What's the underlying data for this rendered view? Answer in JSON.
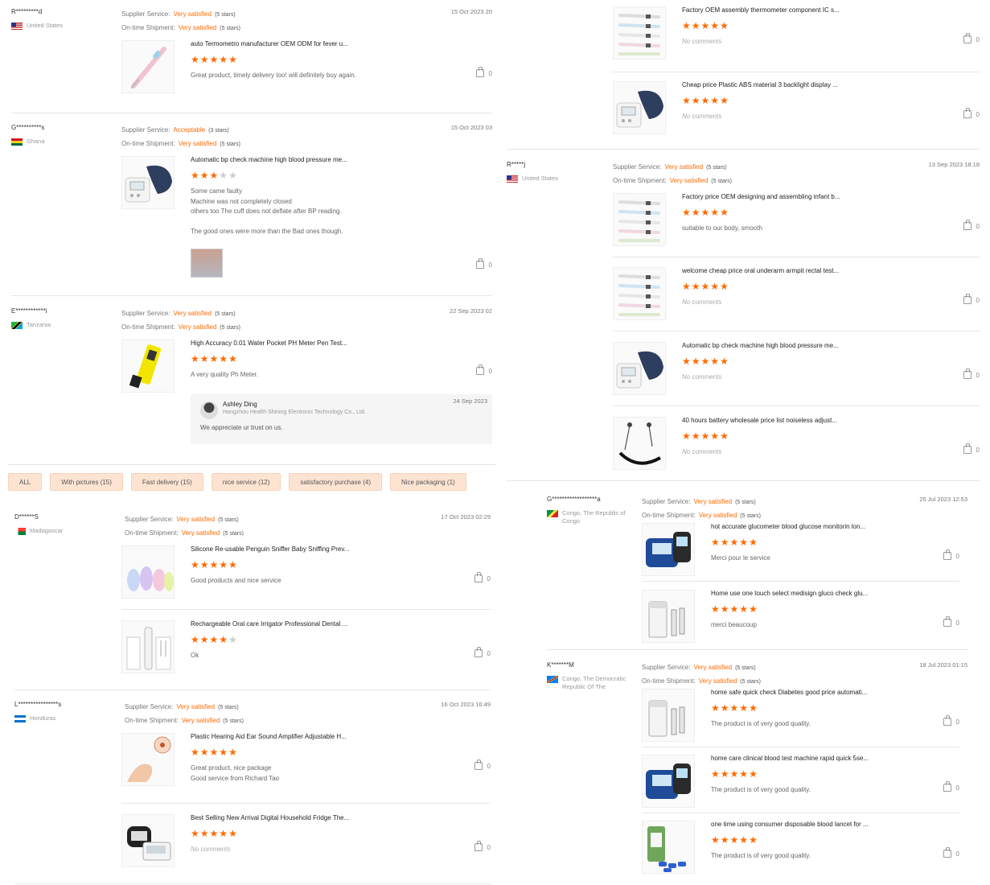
{
  "labels": {
    "supplier": "Supplier Service:",
    "ontime": "On-time Shipment:"
  },
  "tags": [
    "ALL",
    "With pictures (15)",
    "Fast delivery (15)",
    "nice service (12)",
    "satisfactory purchase (4)",
    "Nice packaging (1)"
  ],
  "reviews": [
    {
      "user": "R*********d",
      "country": "United States",
      "flag": "us",
      "supplier_rating": "Very satisfied",
      "supplier_stars": "(5 stars)",
      "ontime_rating": "Very satisfied",
      "ontime_stars": "(5 stars)",
      "date": "15 Oct 2023 20",
      "products": [
        {
          "title": "auto Termometro manufacturer OEM ODM for fever u...",
          "stars": 5,
          "comment": "Great product, timely delivery too! will definitely buy again.",
          "likes": "0",
          "icon": "thermometer-icon"
        }
      ]
    },
    {
      "user": "G**********s",
      "country": "Ghana",
      "flag": "gh",
      "supplier_rating": "Acceptable",
      "supplier_stars": "(3 stars)",
      "ontime_rating": "Very satisfied",
      "ontime_stars": "(5 stars)",
      "date": "15 Oct 2023 03",
      "products": [
        {
          "title": "Automatic bp check machine high blood pressure me...",
          "stars": 3,
          "comment": "Some came faulty\nMachine was not completely closed\nothers too The cuff does not deflate after BP reading.\n\nThe good ones were more than the Bad ones though.",
          "likes": "0",
          "icon": "bp-monitor-icon"
        }
      ]
    },
    {
      "user": "E************i",
      "country": "Tanzania",
      "flag": "tz",
      "supplier_rating": "Very satisfied",
      "supplier_stars": "(5 stars)",
      "ontime_rating": "Very satisfied",
      "ontime_stars": "(5 stars)",
      "date": "22 Sep 2023 02",
      "products": [
        {
          "title": "High Accuracy 0.01 Water Pocket PH Meter Pen Test...",
          "stars": 5,
          "comment": "A very quality Ph Meter.",
          "likes": "0",
          "icon": "ph-meter-icon"
        }
      ],
      "reply": {
        "name": "Ashley Ding",
        "company": "Hangzhou Health Shining Electronic Technology Co., Ltd.",
        "date": "24 Sep 2023",
        "text": "We appreciate ur trust on us."
      }
    },
    {
      "user": "D******S",
      "country": "Madagascar",
      "flag": "mg",
      "supplier_rating": "Very satisfied",
      "supplier_stars": "(5 stars)",
      "ontime_rating": "Very satisfied",
      "ontime_stars": "(5 stars)",
      "date": "17 Oct 2023 02:29",
      "products": [
        {
          "title": "Silicone Re-usable Penguin Sniffer Baby Sniffing Prev...",
          "stars": 5,
          "comment": "Good products and nice service",
          "likes": "0",
          "icon": "nasal-aspirator-icon"
        },
        {
          "title": "Rechargeable Oral care Irrigator Professional Dental ...",
          "stars": 4,
          "comment": "Ok",
          "likes": "0",
          "icon": "oral-irrigator-icon"
        }
      ]
    },
    {
      "user": "L****************s",
      "country": "Honduras",
      "flag": "hn",
      "supplier_rating": "Very satisfied",
      "supplier_stars": "(5 stars)",
      "ontime_rating": "Very satisfied",
      "ontime_stars": "(5 stars)",
      "date": "16 Oct 2023 16:49",
      "products": [
        {
          "title": "Plastic Hearing Aid Ear Sound Amplifier Adjustable H...",
          "stars": 5,
          "comment": "Great product, nice package\nGood service from Richard Tao",
          "likes": "0",
          "icon": "hearing-aid-icon"
        },
        {
          "title": "Best Selling New Arrival Digital Household Fridge The...",
          "stars": 5,
          "comment": "No comments",
          "likes": "0",
          "icon": "fridge-thermometer-icon"
        }
      ]
    },
    {
      "user": "",
      "country": "",
      "flag": "",
      "supplier_rating": "",
      "supplier_stars": "",
      "ontime_rating": "",
      "ontime_stars": "",
      "date": "",
      "products": [
        {
          "title": "Factory OEM assembly thermometer component IC s...",
          "stars": 5,
          "comment": "No comments",
          "likes": "0",
          "icon": "thermometer-set-icon"
        },
        {
          "title": "Cheap price Plastic ABS material 3 backlight display ...",
          "stars": 5,
          "comment": "No comments",
          "likes": "0",
          "icon": "bp-monitor-icon"
        }
      ]
    },
    {
      "user": "R*****j",
      "country": "United States",
      "flag": "us",
      "supplier_rating": "Very satisfied",
      "supplier_stars": "(5 stars)",
      "ontime_rating": "Very satisfied",
      "ontime_stars": "(5 stars)",
      "date": "13 Sep 2023 18:18",
      "products": [
        {
          "title": "Factory price OEM designing and assembling infant b...",
          "stars": 5,
          "comment": "suitable to our body, smooth",
          "likes": "0",
          "icon": "thermometer-set-icon"
        },
        {
          "title": "welcome cheap price oral underarm armpit rectal test...",
          "stars": 5,
          "comment": "No comments",
          "likes": "0",
          "icon": "thermometer-set-icon"
        },
        {
          "title": "Automatic bp check machine high blood pressure me...",
          "stars": 5,
          "comment": "No comments",
          "likes": "0",
          "icon": "bp-monitor-icon"
        },
        {
          "title": "40 hours battery wholesale price list noiseless adjust...",
          "stars": 5,
          "comment": "No comments",
          "likes": "0",
          "icon": "neckband-earphones-icon"
        }
      ]
    },
    {
      "user": "G******************a",
      "country": "Congo, The Republic of Congo",
      "flag": "cg",
      "supplier_rating": "Very satisfied",
      "supplier_stars": "(5 stars)",
      "ontime_rating": "Very satisfied",
      "ontime_stars": "(5 stars)",
      "date": "25 Jul 2023 12:53",
      "products": [
        {
          "title": "hot accurate glucometer blood glucose monitorin lon...",
          "stars": 5,
          "comment": "Merci pour le service",
          "likes": "0",
          "icon": "glucometer-icon"
        },
        {
          "title": "Home use one touch select medisign gluco check glu...",
          "stars": 5,
          "comment": "merci beaucoup",
          "likes": "0",
          "icon": "test-strips-icon"
        }
      ]
    },
    {
      "user": "K*******M",
      "country": "Congo, The Democratic Republic Of The",
      "flag": "cd",
      "supplier_rating": "Very satisfied",
      "supplier_stars": "(5 stars)",
      "ontime_rating": "Very satisfied",
      "ontime_stars": "(5 stars)",
      "date": "18 Jul 2023 01:15",
      "products": [
        {
          "title": "home safe quick check Diabetes good price automati...",
          "stars": 5,
          "comment": "The product is of very good quality.",
          "likes": "0",
          "icon": "test-strips-icon"
        },
        {
          "title": "home care clinical blood test machine rapid quick 5se...",
          "stars": 5,
          "comment": "The product is of very good quality.",
          "likes": "0",
          "icon": "glucometer-icon"
        },
        {
          "title": "one time using consumer disposable blood lancet for ...",
          "stars": 5,
          "comment": "The product is of very good quality.",
          "likes": "0",
          "icon": "lancet-icon"
        }
      ]
    }
  ]
}
